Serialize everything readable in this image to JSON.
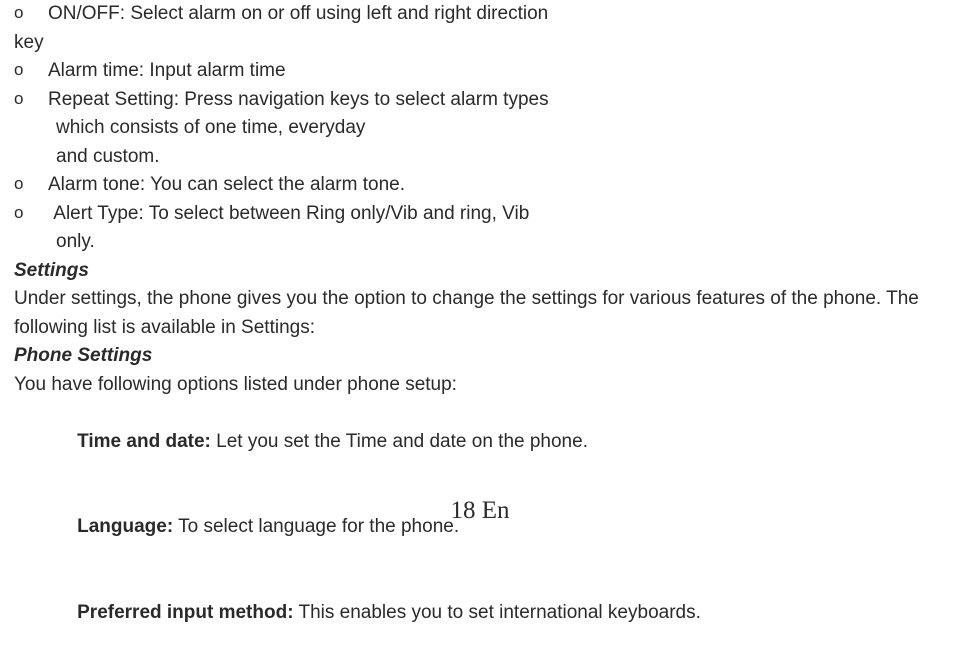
{
  "bullets": {
    "onoff": {
      "line1": "ON/OFF: Select alarm on or off using left and right direction",
      "line2": "key"
    },
    "alarmTime": "Alarm time: Input alarm time",
    "repeat": {
      "line1": "Repeat Setting: Press navigation keys to select alarm types",
      "line2": "which consists of one time, everyday",
      "line3": "and custom."
    },
    "alarmTone": "Alarm tone: You can select the alarm tone.",
    "alertType": {
      "line1": " Alert Type: To select between Ring only/Vib and ring, Vib",
      "line2": "only."
    }
  },
  "settings": {
    "heading": "Settings",
    "body": "Under settings, the phone gives you the option to change the settings for various features of the phone. The following list is available in Settings:"
  },
  "phoneSettings": {
    "heading": "Phone Settings",
    "intro": "You have following options listed under phone setup:",
    "timeLabel": "Time and date: ",
    "timeRest": "Let you set the Time and date on the phone.",
    "langLabel": "Language:",
    "langRest": " To select language for the phone.",
    "inputLabel": "Preferred input method:",
    "inputRest": " This enables you to set international keyboards."
  },
  "footer": "18 En"
}
